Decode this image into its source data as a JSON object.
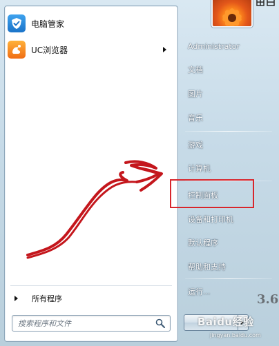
{
  "pinned": [
    {
      "label": "电脑管家",
      "icon": "shield-check-icon",
      "submenu": false
    },
    {
      "label": "UC浏览器",
      "icon": "uc-squirrel-icon",
      "submenu": true
    }
  ],
  "all_programs": {
    "label": "所有程序"
  },
  "search": {
    "placeholder": "搜索程序和文件"
  },
  "right_items": {
    "user": "Administrator",
    "documents": "文档",
    "pictures": "图片",
    "music": "音乐",
    "games": "游戏",
    "computer": "计算机",
    "control_panel": "控制面板",
    "devices_printers": "设备和打印机",
    "default_programs": "默认程序",
    "help_support": "帮助和支持",
    "run": "运行..."
  },
  "side_number": "3.6",
  "watermark": {
    "brand": "Baidu经验",
    "url": "jingyan.baidu.com"
  },
  "colors": {
    "highlight": "#d8262c",
    "arrow": "#c4161c",
    "pane_blue": "#c7dbe8"
  }
}
